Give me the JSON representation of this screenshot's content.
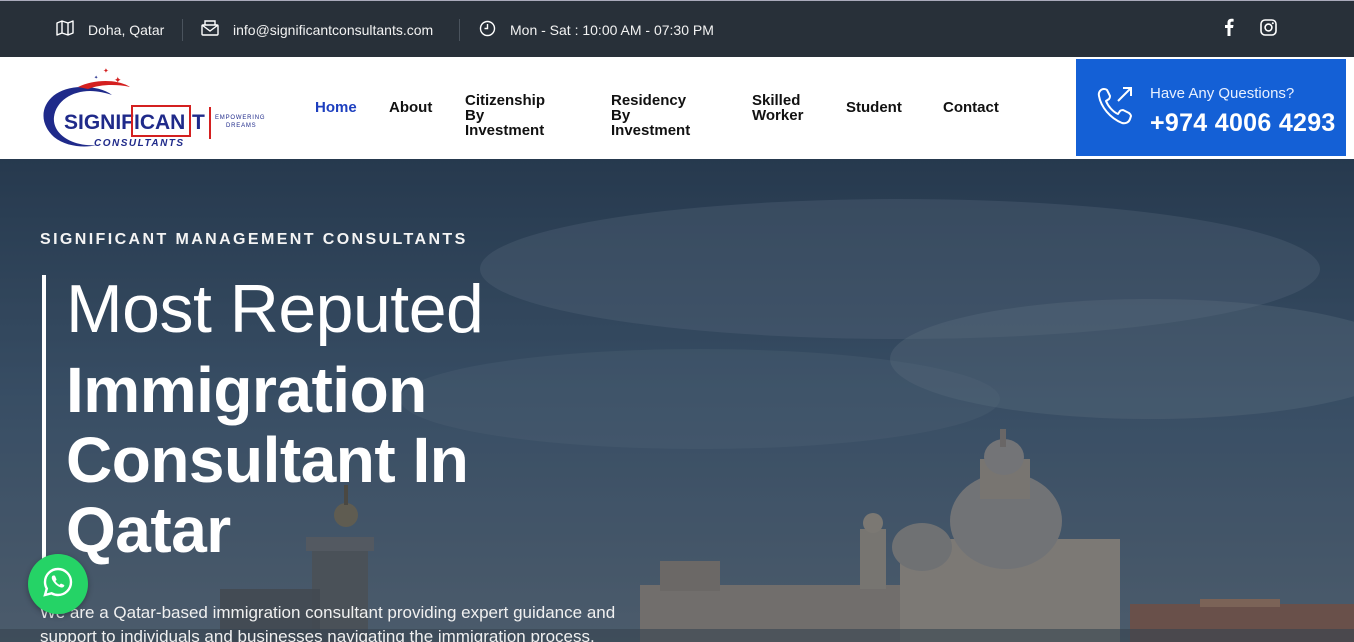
{
  "topbar": {
    "location": "Doha, Qatar",
    "email": "info@significantconsultants.com",
    "hours": "Mon - Sat : 10:00 AM - 07:30 PM",
    "location_icon": "map-icon",
    "email_icon": "envelope-icon",
    "hours_icon": "clock-icon",
    "social": [
      "facebook-icon",
      "instagram-icon"
    ]
  },
  "logo": {
    "brand_left": "SIGNIF",
    "brand_box": "ICAN",
    "brand_right": "T",
    "subtitle": "CONSULTANTS",
    "tagline_1": "EMPOWERING",
    "tagline_2": "DREAMS"
  },
  "nav": {
    "home": "Home",
    "about": "About",
    "citizenship_1": "Citizenship By",
    "citizenship_2": "Investment",
    "residency_1": "Residency By",
    "residency_2": "Investment",
    "skilled_1": "Skilled",
    "skilled_2": "Worker",
    "student": "Student",
    "contact": "Contact"
  },
  "cta": {
    "question": "Have Any Questions?",
    "phone": "+974 4006 4293",
    "icon": "phone-icon",
    "accent": "#1460d6"
  },
  "hero": {
    "eyebrow": "SIGNIFICANT MANAGEMENT CONSULTANTS",
    "heading_light": "Most Reputed",
    "heading_bold_1": "Immigration",
    "heading_bold_2": "Consultant In",
    "heading_bold_3": "Qatar",
    "description": "We are a Qatar-based immigration consultant providing expert guidance and support to individuals and businesses navigating the immigration process."
  },
  "whatsapp": {
    "icon": "whatsapp-icon",
    "color": "#25d366"
  },
  "colors": {
    "topbar": "#283039",
    "nav_active": "#1d3fbf",
    "accent": "#1460d6"
  }
}
